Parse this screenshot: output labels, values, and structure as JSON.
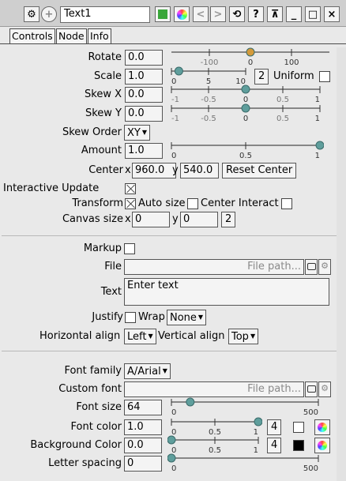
{
  "window": {
    "title": "Text1",
    "tabs": [
      "Controls",
      "Node",
      "Info"
    ]
  },
  "titlebar_icons": [
    "gear-icon",
    "add-circle-icon",
    "green-square-icon",
    "color-circle-icon",
    "chevron-left-icon",
    "chevron-right-icon",
    "restore-icon",
    "help-icon",
    "pin-icon",
    "minimize-icon",
    "maximize-icon",
    "close-icon"
  ],
  "titlebar_glyphs": {
    "gear": "⚙",
    "add": "+",
    "left": "<",
    "right": ">",
    "restore": "⟲",
    "help": "?",
    "pin": "⊼",
    "minimize": "_",
    "maximize": "□",
    "close": "×"
  },
  "transform": {
    "rotate": {
      "label": "Rotate",
      "value": "0.0",
      "ticks": [
        "-100",
        "0",
        "100"
      ],
      "level": 0.5
    },
    "scale": {
      "label": "Scale",
      "value": "1.0",
      "ticks": [
        "0",
        "5",
        "10"
      ],
      "level": 0.1,
      "step": "2",
      "uniform_label": "Uniform",
      "uniform": false
    },
    "skew_x": {
      "label": "Skew X",
      "value": "0.0",
      "ticks": [
        "-1",
        "-0.5",
        "0",
        "0.5",
        "1"
      ],
      "level": 0.5
    },
    "skew_y": {
      "label": "Skew Y",
      "value": "0.0",
      "ticks": [
        "-1",
        "-0.5",
        "0",
        "0.5",
        "1"
      ],
      "level": 0.5
    },
    "skew_order": {
      "label": "Skew Order",
      "value": "XY"
    },
    "amount": {
      "label": "Amount",
      "value": "1.0",
      "ticks": [
        "0",
        "0.5",
        "1"
      ],
      "level": 1.0
    },
    "center": {
      "label": "Center",
      "x_label": "x",
      "x": "960.0",
      "y_label": "y",
      "y": "540.0",
      "reset_label": "Reset Center"
    },
    "interactive_update": {
      "label": "Interactive Update",
      "checked": true
    },
    "transform_row": {
      "label": "Transform",
      "checked": true,
      "auto_size_label": "Auto size",
      "auto_size": false,
      "center_interact_label": "Center Interact",
      "center_interact": false
    },
    "canvas_size": {
      "label": "Canvas size",
      "x_label": "x",
      "x": "0",
      "y_label": "y",
      "y": "0",
      "step": "2"
    }
  },
  "text": {
    "markup": {
      "label": "Markup",
      "checked": false
    },
    "file": {
      "label": "File",
      "placeholder": "File path..."
    },
    "text": {
      "label": "Text",
      "placeholder": "Enter text"
    },
    "justify": {
      "label": "Justify",
      "checked": false,
      "wrap_label": "Wrap",
      "wrap_value": "None"
    },
    "align": {
      "h_label": "Horizontal align",
      "h_value": "Left",
      "v_label": "Vertical align",
      "v_value": "Top"
    }
  },
  "font": {
    "family": {
      "label": "Font family",
      "value": "A/Arial"
    },
    "custom": {
      "label": "Custom font",
      "placeholder": "File path..."
    },
    "size": {
      "label": "Font size",
      "value": "64",
      "ticks": [
        "0",
        "500"
      ],
      "level": 0.128
    },
    "color": {
      "label": "Font color",
      "value": "1.0",
      "ticks": [
        "0",
        "0.5",
        "1"
      ],
      "level": 1.0,
      "step": "4",
      "swatch": "#ffffff"
    },
    "bg_color": {
      "label": "Background Color",
      "value": "0.0",
      "ticks": [
        "0",
        "0.5",
        "1"
      ],
      "level": 0.0,
      "step": "4",
      "swatch": "#000000"
    },
    "letter_spacing": {
      "label": "Letter spacing",
      "value": "0",
      "ticks": [
        "0",
        "500"
      ],
      "level": 0.0
    }
  },
  "colors": {
    "accent": "#5aa0a0",
    "knob": "#5f9e9c",
    "knob_orange": "#d49a3a",
    "green_btn": "#3aa63a"
  }
}
